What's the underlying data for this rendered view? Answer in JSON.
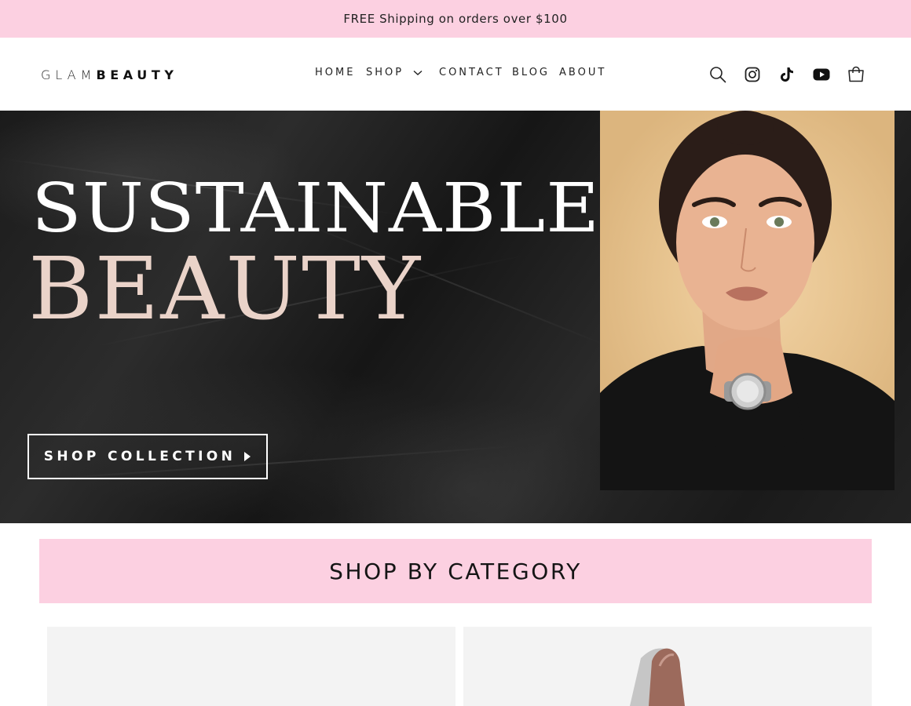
{
  "announcement": {
    "text": "FREE Shipping on orders over $100"
  },
  "header": {
    "logo_light": "GLAM",
    "logo_bold": "BEAUTY",
    "nav": [
      {
        "label": "HOME"
      },
      {
        "label": "SHOP"
      },
      {
        "label": "CONTACT"
      },
      {
        "label": "BLOG"
      },
      {
        "label": "ABOUT"
      }
    ],
    "icons": [
      "search-icon",
      "instagram-icon",
      "tiktok-icon",
      "youtube-icon",
      "cart-icon"
    ]
  },
  "hero": {
    "title_line1": "SUSTAINABLE",
    "title_line2": "BEAUTY",
    "cta_label": "SHOP COLLECTION"
  },
  "categories": {
    "heading": "SHOP BY CATEGORY"
  },
  "colors": {
    "accent_pink": "#fcd0e1",
    "title_blush": "#ead3c9"
  }
}
